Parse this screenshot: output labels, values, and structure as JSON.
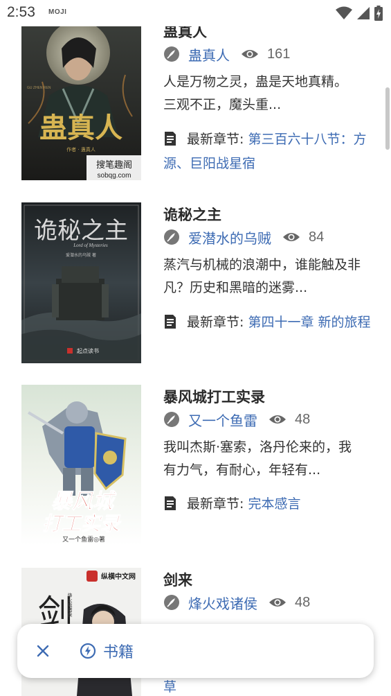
{
  "status_bar": {
    "time": "2:53",
    "app_badge": "MOJI",
    "icons": [
      "wifi-icon",
      "cell-signal-icon",
      "battery-charging-icon"
    ]
  },
  "books": [
    {
      "title": "蛊真人",
      "author": "蛊真人",
      "views": "161",
      "description": "人是万物之灵，蛊是天地真精。　三观不正，魔头重...",
      "latest_label": "最新章节: ",
      "latest_chapter": "第三百六十八节：方源、巨阳战星宿",
      "cover": {
        "big_text": "蛊真人",
        "sub_text": "作者 · 蛊真人",
        "caption_top": "GU ZHEN REN",
        "badge": "搜笔趣阁",
        "badge_url": "sobqg.com"
      }
    },
    {
      "title": "诡秘之主",
      "author": "爱潜水的乌贼",
      "views": "84",
      "description": "蒸汽与机械的浪潮中，谁能触及非凡？历史和黑暗的迷雾...",
      "latest_label": "最新章节: ",
      "latest_chapter": "第四十一章 新的旅程",
      "cover": {
        "big_text": "诡秘之主",
        "sub_text": "Lord of Mysteries",
        "author_small": "爱潜水的乌贼 著",
        "badge": "起点读书"
      }
    },
    {
      "title": "暴风城打工实录",
      "author": "又一个鱼雷",
      "views": "48",
      "description": "我叫杰斯·塞索，洛丹伦来的，我有力气，有耐心，年轻有...",
      "latest_label": "最新章节: ",
      "latest_chapter": "完本感言",
      "cover": {
        "big_text_1": "暴风城",
        "big_text_2": "打工实录",
        "sub_text": "又一个鱼雷◎著"
      }
    },
    {
      "title": "剑来",
      "author": "烽火戏诸侯",
      "views": "48",
      "description": "",
      "latest_label": "",
      "latest_chapter": "草",
      "cover": {
        "big_text": "剑",
        "author_small": "烽火戏诸侯",
        "badge": "纵横中文网"
      }
    }
  ],
  "float_bar": {
    "close_icon": "close-icon",
    "books_icon": "bolt-icon",
    "books_label": "书籍"
  },
  "colors": {
    "accent": "#3d6bb3",
    "text": "#333333",
    "muted": "#666666"
  }
}
